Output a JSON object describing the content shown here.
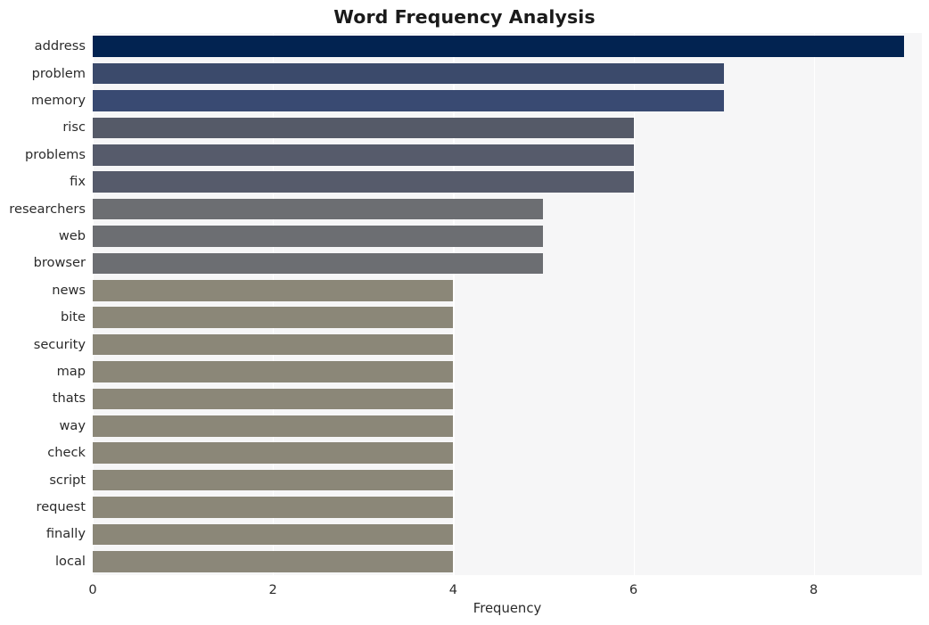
{
  "chart_data": {
    "type": "bar",
    "orientation": "horizontal",
    "title": "Word Frequency Analysis",
    "xlabel": "Frequency",
    "ylabel": "",
    "xlim": [
      0,
      9.2
    ],
    "xticks": [
      0,
      2,
      4,
      6,
      8
    ],
    "xtick_labels": [
      "0",
      "2",
      "4",
      "6",
      "8"
    ],
    "grid": "vertical-only",
    "legend": "none",
    "categories": [
      "address",
      "problem",
      "memory",
      "risc",
      "problems",
      "fix",
      "researchers",
      "web",
      "browser",
      "news",
      "bite",
      "security",
      "map",
      "thats",
      "way",
      "check",
      "script",
      "request",
      "finally",
      "local"
    ],
    "values": [
      9,
      7,
      7,
      6,
      6,
      6,
      5,
      5,
      5,
      4,
      4,
      4,
      4,
      4,
      4,
      4,
      4,
      4,
      4,
      4
    ],
    "bar_colors": [
      "#022351",
      "#3b4a6b",
      "#394a72",
      "#555a68",
      "#565b6b",
      "#565b6b",
      "#6c6e72",
      "#6c6e72",
      "#6c6e72",
      "#8b8778",
      "#8b8778",
      "#8b8778",
      "#8b8778",
      "#8b8778",
      "#8b8778",
      "#8b8778",
      "#8b8778",
      "#8b8778",
      "#8b8778",
      "#8b8779"
    ],
    "plot_background": "#f6f6f7",
    "gridline_color": "#ffffff",
    "figure_background": "#ffffff",
    "text_color": "#2b2b2b"
  }
}
